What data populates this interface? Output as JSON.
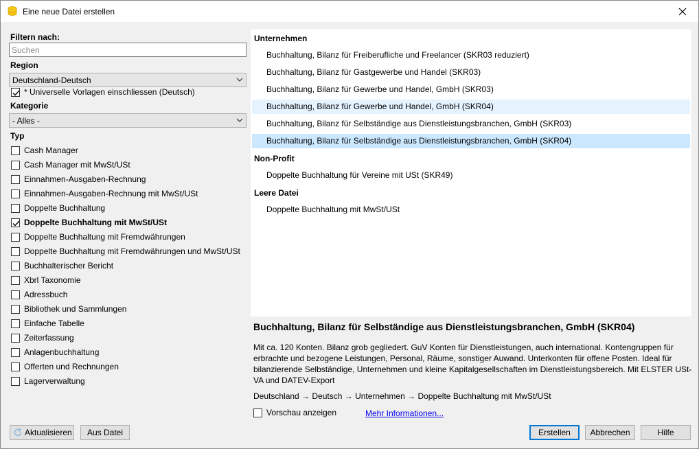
{
  "window": {
    "title": "Eine neue Datei erstellen"
  },
  "filter": {
    "label": "Filtern nach:",
    "search_placeholder": "Suchen",
    "region_label": "Region",
    "region_value": "Deutschland-Deutsch",
    "universal_label": "* Universelle Vorlagen einschliessen (Deutsch)",
    "category_label": "Kategorie",
    "category_value": "- Alles -",
    "type_label": "Typ"
  },
  "types": [
    {
      "label": "Cash Manager",
      "checked": false
    },
    {
      "label": "Cash Manager mit MwSt/USt",
      "checked": false
    },
    {
      "label": "Einnahmen-Ausgaben-Rechnung",
      "checked": false
    },
    {
      "label": "Einnahmen-Ausgaben-Rechnung mit MwSt/USt",
      "checked": false
    },
    {
      "label": "Doppelte Buchhaltung",
      "checked": false
    },
    {
      "label": "Doppelte Buchhaltung mit MwSt/USt",
      "checked": true
    },
    {
      "label": "Doppelte Buchhaltung mit Fremdwährungen",
      "checked": false
    },
    {
      "label": "Doppelte Buchhaltung mit Fremdwährungen und MwSt/USt",
      "checked": false
    },
    {
      "label": "Buchhalterischer Bericht",
      "checked": false
    },
    {
      "label": "Xbrl Taxonomie",
      "checked": false
    },
    {
      "label": "Adressbuch",
      "checked": false
    },
    {
      "label": "Bibliothek und Sammlungen",
      "checked": false
    },
    {
      "label": "Einfache Tabelle",
      "checked": false
    },
    {
      "label": "Zeiterfassung",
      "checked": false
    },
    {
      "label": "Anlagenbuchhaltung",
      "checked": false
    },
    {
      "label": "Offerten und Rechnungen",
      "checked": false
    },
    {
      "label": "Lagerverwaltung",
      "checked": false
    }
  ],
  "groups": {
    "unternehmen": "Unternehmen",
    "nonprofit": "Non-Profit",
    "leer": "Leere Datei"
  },
  "templates": {
    "u1": "Buchhaltung, Bilanz für Freiberufliche und Freelancer (SKR03 reduziert)",
    "u2": "Buchhaltung, Bilanz für Gastgewerbe und Handel (SKR03)",
    "u3": "Buchhaltung, Bilanz für Gewerbe und Handel, GmbH (SKR03)",
    "u4": "Buchhaltung, Bilanz für Gewerbe und Handel, GmbH (SKR04)",
    "u5": "Buchhaltung, Bilanz für Selbständige aus Dienstleistungsbranchen, GmbH (SKR03)",
    "u6": "Buchhaltung, Bilanz für Selbständige aus Dienstleistungsbranchen, GmbH (SKR04)",
    "n1": "Doppelte Buchhaltung für Vereine mit USt (SKR49)",
    "l1": "Doppelte Buchhaltung mit MwSt/USt"
  },
  "detail": {
    "title": "Buchhaltung, Bilanz für Selbständige aus Dienstleistungsbranchen, GmbH (SKR04)",
    "description": "Mit ca. 120 Konten. Bilanz grob gegliedert. GuV Konten für Dienstleistungen, auch international. Kontengruppen für erbrachte und bezogene Leistungen, Personal, Räume, sonstiger Auwand. Unterkonten für offene Posten. Ideal für bilanzierende Selbständige, Unternehmen und kleine Kapitalgesellschaften im Dienstleistungsbereich. Mit ELSTER USt-VA und DATEV-Export",
    "path": "Deutschland → Deutsch → Unternehmen → Doppelte Buchhaltung mit MwSt/USt",
    "preview_label": "Vorschau anzeigen",
    "more_link": "Mehr Informationen..."
  },
  "buttons": {
    "refresh": "Aktualisieren",
    "from_file": "Aus Datei",
    "create": "Erstellen",
    "cancel": "Abbrechen",
    "help": "Hilfe"
  },
  "colors": {
    "selection": "#cce8ff",
    "hover": "#e5f3ff",
    "accent": "#0078d7",
    "link": "#0000ee",
    "app_icon": "#f5c518"
  }
}
